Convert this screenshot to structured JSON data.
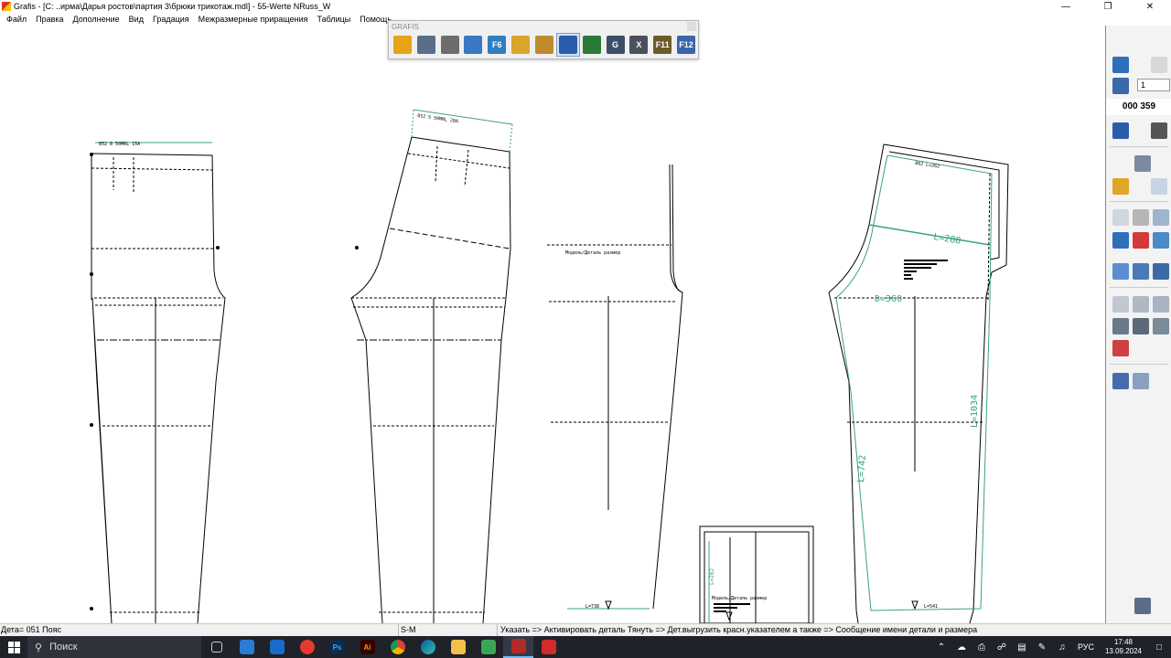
{
  "window": {
    "title": "Grafis - [C: ..ирма\\Дарья ростов\\партия 3\\брюки трикотаж.mdl] - 55-Werte NRuss_W",
    "minimize": "—",
    "restore": "❐",
    "close": "✕"
  },
  "menu": [
    "Файл",
    "Правка",
    "Дополнение",
    "Вид",
    "Градация",
    "Межразмерные приращения",
    "Таблицы",
    "Помощь"
  ],
  "grafis_toolbar": {
    "title": "GRAFIS",
    "buttons": [
      {
        "name": "open-icon",
        "glyph": "",
        "color": "#e8a317"
      },
      {
        "name": "save-icon",
        "glyph": "",
        "color": "#5a6e8a"
      },
      {
        "name": "print-icon",
        "glyph": "",
        "color": "#6d6d6d"
      },
      {
        "name": "zoom-icon",
        "glyph": "",
        "color": "#3a78c2"
      },
      {
        "name": "f6-icon",
        "glyph": "F6",
        "color": "#2d7fbf"
      },
      {
        "name": "layer-icon",
        "glyph": "",
        "color": "#d9a52b"
      },
      {
        "name": "measure-icon",
        "glyph": "",
        "color": "#c08a2e"
      },
      {
        "name": "export-down-icon",
        "glyph": "",
        "color": "#2a5caa"
      },
      {
        "name": "export-down-alt-icon",
        "glyph": "",
        "color": "#2a7a3a"
      },
      {
        "name": "g-icon",
        "glyph": "G",
        "color": "#3b4f6a"
      },
      {
        "name": "x-icon",
        "glyph": "X",
        "color": "#4a5060"
      },
      {
        "name": "f11-icon",
        "glyph": "F11",
        "color": "#6b5a2a"
      },
      {
        "name": "f12-icon",
        "glyph": "F12",
        "color": "#3a64a8"
      }
    ]
  },
  "pattern_labels": {
    "piece1_top": "852 8 50MRL 15A",
    "piece2_top": "852 5 50MRL 28A",
    "piece3_label": "Модель/Деталь размер",
    "piece3_bottom": "L=738",
    "piece5_top": "862 L=262",
    "piece5_a": "L=288",
    "piece5_b": "D=360",
    "piece5_c": "L=1034",
    "piece5_d": "L=742",
    "piece5_bottom": "L=541",
    "piece4_label": "Модель/Деталь размер",
    "piece4_side": "L=262"
  },
  "right_panel": {
    "field_value": "1",
    "counter": "000 359"
  },
  "statusbar": {
    "detail": "Дета= 051  Пояс",
    "size": "S-M",
    "hint": "Указать => Активировать деталь Тянуть => Дет.выгрузить красн.указателем а также => Сообщение имени детали и размера"
  },
  "taskbar": {
    "search_placeholder": "Поиск",
    "language": "РУС",
    "time": "17:48",
    "date": "13.09.2024"
  }
}
